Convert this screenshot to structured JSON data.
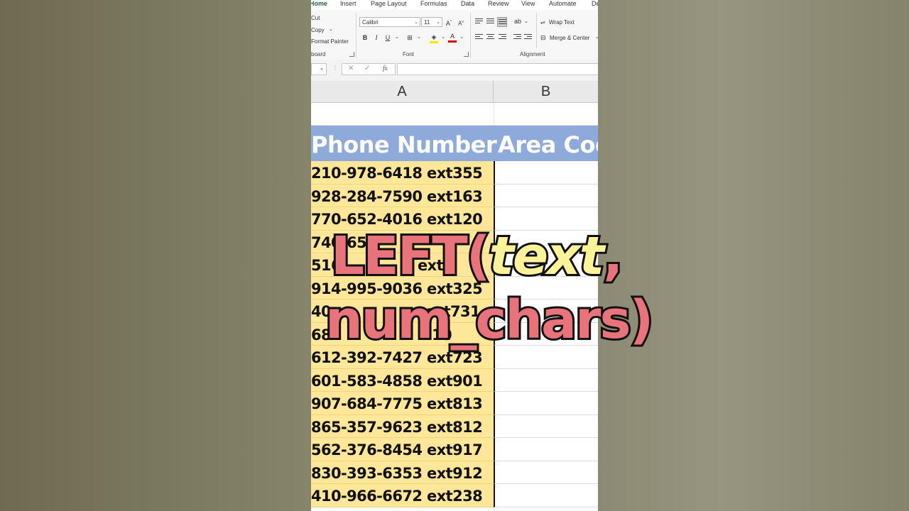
{
  "ribbon": {
    "tabs": [
      "Home",
      "Insert",
      "Page Layout",
      "Formulas",
      "Data",
      "Review",
      "View",
      "Automate",
      "De"
    ],
    "clipboard": {
      "cut": "Cut",
      "copy": "Copy",
      "format_painter": "Format Painter",
      "group_label": "board"
    },
    "font": {
      "family": "Calibri",
      "size": "11",
      "group_label": "Font",
      "bold": "B",
      "italic": "I",
      "underline": "U"
    },
    "alignment": {
      "wrap_text": "Wrap Text",
      "merge_center": "Merge & Center",
      "group_label": "Alignment"
    }
  },
  "formula_bar": {
    "fx": "fx",
    "cancel": "✕",
    "enter": "✓",
    "value": ""
  },
  "sheet": {
    "columns": [
      "A",
      "B"
    ],
    "header": {
      "a": "Phone Number",
      "b": "Area Cod"
    },
    "rows": [
      "210-978-6418 ext355",
      "928-284-7590 ext163",
      "770-652-4016 ext120",
      "740-653",
      "516-",
      "914-995-9036 ext325",
      "40",
      "68",
      "612-392-7427 ext723",
      "601-583-4858 ext901",
      "907-684-7775 ext813",
      "865-357-9623 ext812",
      "562-376-8454 ext917",
      "830-393-6353 ext912",
      "410-966-6672 ext238"
    ],
    "hidden_tail": [
      "",
      "",
      "",
      "",
      "ext3",
      "",
      "ext731",
      "10",
      "",
      "",
      "",
      "",
      "",
      "",
      ""
    ]
  },
  "overlay": {
    "line1_prefix": "LEFT(",
    "line1_arg": "text",
    "line1_suffix": ",",
    "line2": "num_chars)"
  },
  "colors": {
    "header_fill": "#8eaadb",
    "cell_fill": "#ffe699",
    "overlay_pink": "#e8737a",
    "overlay_yellow": "#fbf29a",
    "active_tab": "#1e6b3a"
  }
}
